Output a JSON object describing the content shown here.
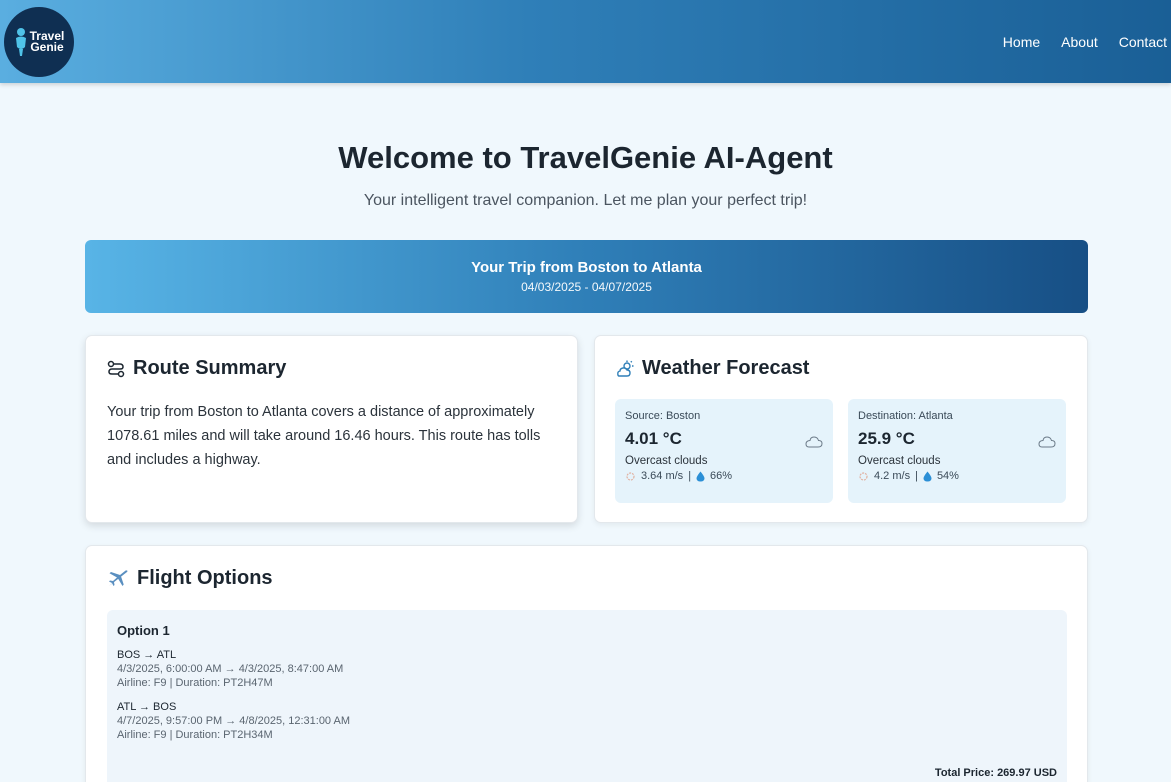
{
  "header": {
    "logo_text_1": "Travel",
    "logo_text_2": "Genie",
    "nav": [
      "Home",
      "About",
      "Contact"
    ]
  },
  "hero": {
    "title": "Welcome to TravelGenie AI-Agent",
    "subtitle": "Your intelligent travel companion. Let me plan your perfect trip!"
  },
  "trip": {
    "title": "Your Trip from Boston to Atlanta",
    "dates": "04/03/2025 - 04/07/2025"
  },
  "route": {
    "heading": "Route Summary",
    "text": "Your trip from Boston to Atlanta covers a distance of approximately 1078.61 miles and will take around 16.46 hours. This route has tolls and includes a highway."
  },
  "weather": {
    "heading": "Weather Forecast",
    "source": {
      "label": "Source: Boston",
      "temp": "4.01 °C",
      "desc": "Overcast clouds",
      "wind": "3.64 m/s",
      "humidity": "66%"
    },
    "destination": {
      "label": "Destination: Atlanta",
      "temp": "25.9 °C",
      "desc": "Overcast clouds",
      "wind": "4.2 m/s",
      "humidity": "54%"
    }
  },
  "flights": {
    "heading": "Flight Options",
    "option": {
      "title": "Option 1",
      "segments": [
        {
          "route": "BOS → ATL",
          "times": "4/3/2025, 6:00:00 AM → 4/3/2025, 8:47:00 AM",
          "meta": "Airline: F9 | Duration: PT2H47M"
        },
        {
          "route": "ATL → BOS",
          "times": "4/7/2025, 9:57:00 PM → 4/8/2025, 12:31:00 AM",
          "meta": "Airline: F9 | Duration: PT2H34M"
        }
      ],
      "total": "Total Price: 269.97 USD"
    }
  },
  "colors": {
    "accent": "#2f7fb8",
    "logo_bg": "#0f2f52",
    "drop": "#2b8fd6"
  }
}
